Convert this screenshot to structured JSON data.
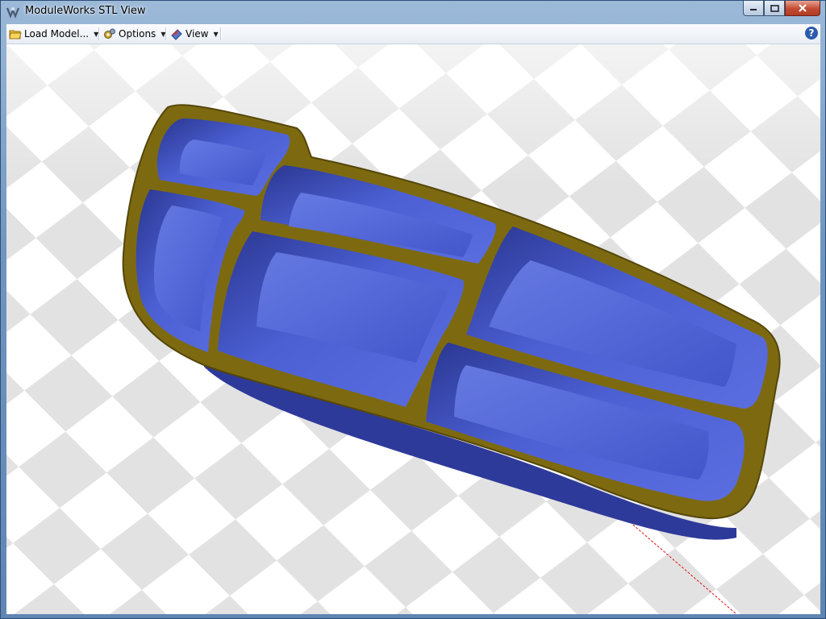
{
  "window": {
    "title": "ModuleWorks STL View"
  },
  "toolbar": {
    "load_model_label": "Load Model...",
    "options_label": "Options",
    "view_label": "View",
    "help_label": "?"
  },
  "icons": {
    "app": "modulework-app-icon",
    "load": "folder-open-icon",
    "options": "gears-icon",
    "view": "camera-view-icon",
    "help": "help-icon"
  },
  "colors": {
    "part_body": "#4a5ed0",
    "part_rim": "#7d6a10",
    "axis_line": "#e01010",
    "checker_light": "#ffffff",
    "checker_dark": "#e2e2e2"
  }
}
